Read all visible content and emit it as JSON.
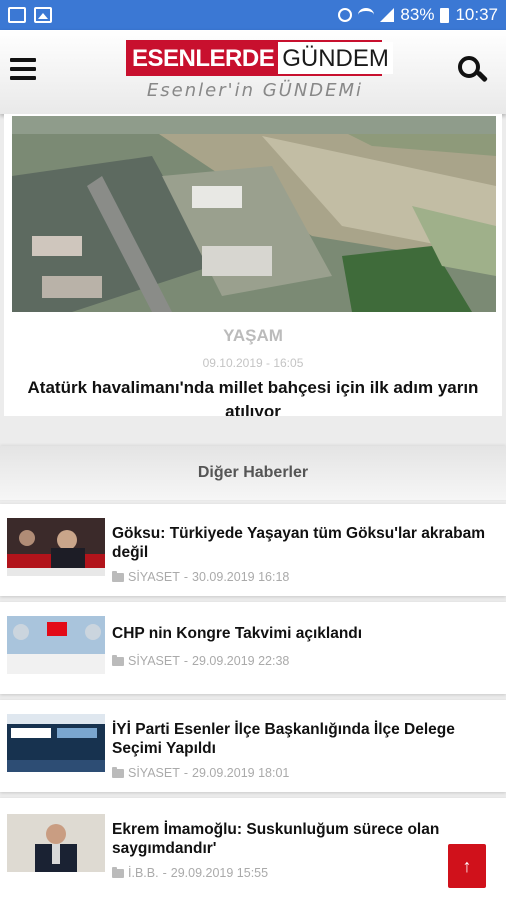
{
  "status_bar": {
    "battery": "83%",
    "time": "10:37"
  },
  "header": {
    "logo_left": "ESENLERDE",
    "logo_right": "GÜNDEM",
    "tagline": "Esenler'in GÜNDEMi"
  },
  "featured": {
    "category": "YAŞAM",
    "date": "09.10.2019 - 16:05",
    "title": "Atatürk havalimanı'nda millet bahçesi için ilk adım yarın atılıyor"
  },
  "section": {
    "title": "Diğer Haberler"
  },
  "news": [
    {
      "title": "Göksu: Türkiyede Yaşayan tüm Göksu'lar akrabam değil",
      "category": "SİYASET",
      "date": "30.09.2019 16:18"
    },
    {
      "title": "CHP nin Kongre Takvimi açıklandı",
      "category": "SİYASET",
      "date": "29.09.2019 22:38"
    },
    {
      "title": "İYİ Parti Esenler İlçe Başkanlığında İlçe Delege Seçimi Yapıldı",
      "category": "SİYASET",
      "date": "29.09.2019 18:01"
    },
    {
      "title": "Ekrem İmamoğlu: Suskunluğum sürece olan saygımdandır'",
      "category": "İ.B.B.",
      "date": "29.09.2019 15:55"
    }
  ],
  "colors": {
    "status_bar": "#3b78d4",
    "brand_red": "#c8102e",
    "scroll_button": "#d0111b"
  }
}
